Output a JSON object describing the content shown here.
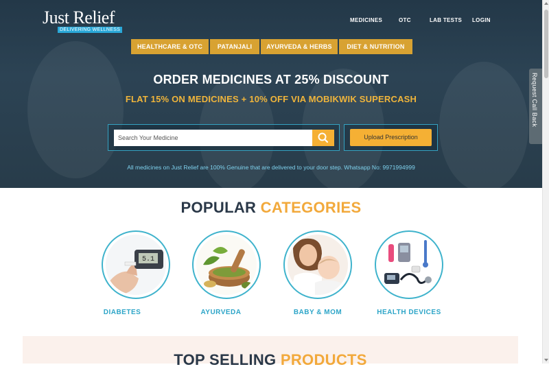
{
  "logo": {
    "name": "Just Relief",
    "tagline": "DELIVERING WELLNESS"
  },
  "topnav": [
    "MEDICINES",
    "OTC",
    "LAB TESTS",
    "LOGIN"
  ],
  "catnav": [
    "HEALTHCARE & OTC",
    "PATANJALI",
    "AYURVEDA & HERBS",
    "DIET & NUTRITION"
  ],
  "hero": {
    "headline": "ORDER MEDICINES AT 25% DISCOUNT",
    "subline": "FLAT 15% ON MEDICINES + 10% OFF VIA MOBIKWIK SUPERCASH",
    "search_placeholder": "Search Your Medicine",
    "upload_label": "Upload Prescription",
    "genuine_note": "All medicines on Just Relief are 100% Genuine that are delivered to your door step. Whatsapp No: 9971994999"
  },
  "callback_label": "Request Call Back",
  "popular": {
    "title_dark": "POPULAR",
    "title_accent": "CATEGORIES"
  },
  "categories": [
    {
      "label": "DIABETES",
      "icon": "glucose-meter-icon"
    },
    {
      "label": "AYURVEDA",
      "icon": "herbs-mortar-icon"
    },
    {
      "label": "BABY & MOM",
      "icon": "mother-baby-icon"
    },
    {
      "label": "HEALTH DEVICES",
      "icon": "medical-devices-icon"
    }
  ],
  "topselling": {
    "title_dark": "TOP SELLING",
    "title_accent": "PRODUCTS"
  },
  "colors": {
    "accent": "#f2a93b",
    "nav_gold": "#d8a232",
    "teal": "#2da5c8",
    "hero_bg": "#2c4354",
    "dark_text": "#2a3848"
  }
}
